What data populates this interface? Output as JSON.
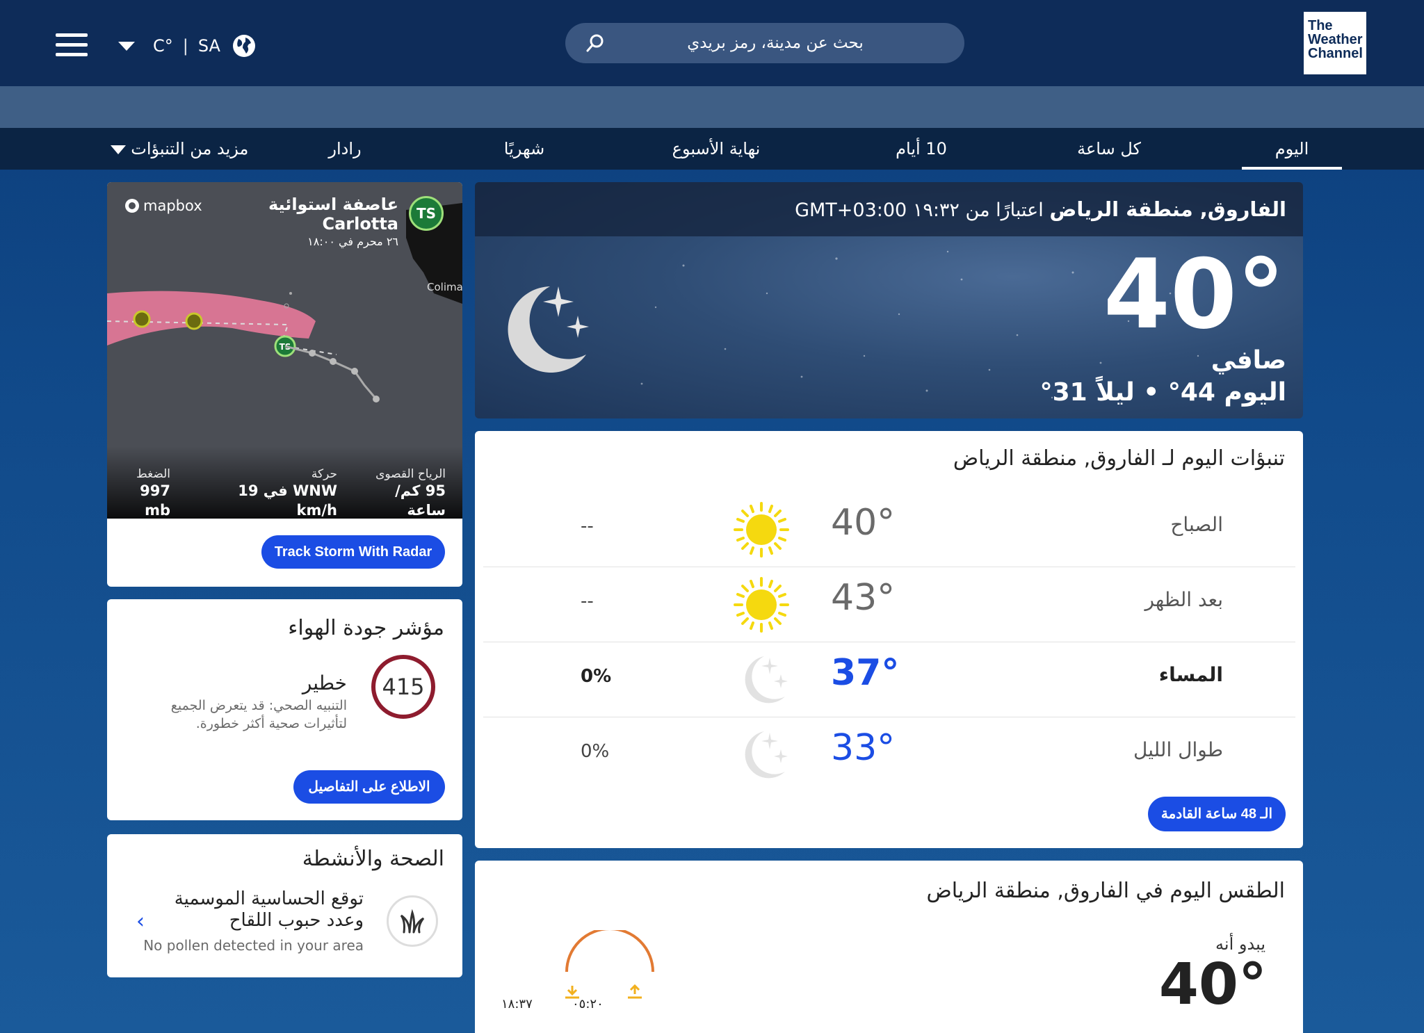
{
  "header": {
    "unit": "C°",
    "divider": "|",
    "region": "SA",
    "search_placeholder": "بحث عن مدينة، رمز بريدي",
    "logo_line1": "The",
    "logo_line2": "Weather",
    "logo_line3": "Channel"
  },
  "nav": {
    "today": "اليوم",
    "hourly": "كل ساعة",
    "ten_day": "10 أيام",
    "weekend": "نهاية الأسبوع",
    "monthly": "شهريًا",
    "radar": "رادار",
    "more": "مزيد من التنبؤات"
  },
  "current": {
    "location": "الفاروق, منطقة الرياض",
    "as_of": "اعتبارًا من ١٩:٣٢ GMT+03:00",
    "temp": "40°",
    "phrase": "صافي",
    "hilo": "اليوم 44° • ليلاً 31°"
  },
  "storm": {
    "mapbox": "mapbox",
    "type": "عاصفة استوائية",
    "name": "Carlotta",
    "time": "٢٦ محرم في ١٨:٠٠",
    "badge": "TS",
    "map_label": "Colima",
    "wind_label": "الرياح القصوى",
    "wind_value1": "95 كم/",
    "wind_value2": "ساعة",
    "move_label": "حركة",
    "move_value1": "WNW في 19",
    "move_value2": "km/h",
    "press_label": "الضغط",
    "press_value1": "997",
    "press_value2": "mb",
    "button": "Track Storm With Radar"
  },
  "air_quality": {
    "title": "مؤشر جودة الهواء",
    "value": "415",
    "severity": "خطير",
    "description": "التنبيه الصحي: قد يتعرض الجميع لتأثيرات صحية أكثر خطورة.",
    "button": "الاطلاع على التفاصيل",
    "ring_color": "#8e1c2e"
  },
  "health": {
    "title": "الصحة والأنشطة",
    "line1": "توقع الحساسية الموسمية",
    "line2": "وعدد حبوب اللقاح",
    "status": "No pollen detected in your area"
  },
  "today_forecast": {
    "title": "تنبؤات اليوم لـ الفاروق, منطقة الرياض",
    "rows": [
      {
        "name": "الصباح",
        "temp": "40°",
        "icon": "sun-icon",
        "precip": "--"
      },
      {
        "name": "بعد الظهر",
        "temp": "43°",
        "icon": "sun-icon",
        "precip": "--"
      },
      {
        "name": "المساء",
        "temp": "37°",
        "icon": "moon-icon",
        "precip": "0%"
      },
      {
        "name": "طوال الليل",
        "temp": "33°",
        "icon": "moon-icon",
        "precip": "0%"
      }
    ],
    "button": "الـ 48 ساعة القادمة"
  },
  "today_details": {
    "title": "الطقس اليوم في الفاروق, منطقة الرياض",
    "feels_label": "يبدو أنه",
    "feels_temp": "40°",
    "sunrise": "٠٥:٢٠",
    "sunset": "١٨:٣٧"
  },
  "colors": {
    "topbar": "#0e2c59",
    "accent": "#1b4de4",
    "sun": "#f5d90f",
    "storm_track": "#e77a9a"
  }
}
